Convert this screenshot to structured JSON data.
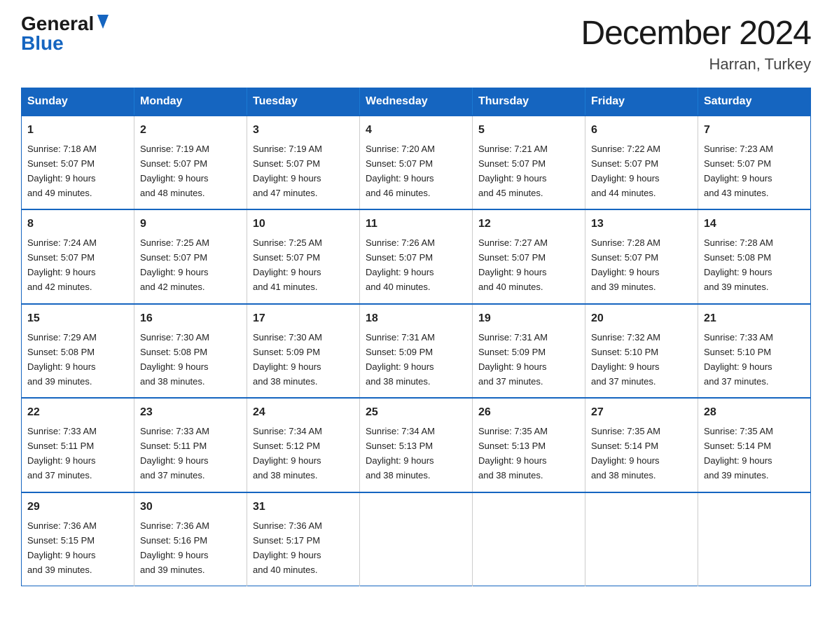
{
  "header": {
    "logo_general": "General",
    "logo_blue": "Blue",
    "title": "December 2024",
    "subtitle": "Harran, Turkey"
  },
  "days_of_week": [
    "Sunday",
    "Monday",
    "Tuesday",
    "Wednesday",
    "Thursday",
    "Friday",
    "Saturday"
  ],
  "weeks": [
    [
      {
        "day": "1",
        "sunrise": "7:18 AM",
        "sunset": "5:07 PM",
        "daylight": "9 hours and 49 minutes."
      },
      {
        "day": "2",
        "sunrise": "7:19 AM",
        "sunset": "5:07 PM",
        "daylight": "9 hours and 48 minutes."
      },
      {
        "day": "3",
        "sunrise": "7:19 AM",
        "sunset": "5:07 PM",
        "daylight": "9 hours and 47 minutes."
      },
      {
        "day": "4",
        "sunrise": "7:20 AM",
        "sunset": "5:07 PM",
        "daylight": "9 hours and 46 minutes."
      },
      {
        "day": "5",
        "sunrise": "7:21 AM",
        "sunset": "5:07 PM",
        "daylight": "9 hours and 45 minutes."
      },
      {
        "day": "6",
        "sunrise": "7:22 AM",
        "sunset": "5:07 PM",
        "daylight": "9 hours and 44 minutes."
      },
      {
        "day": "7",
        "sunrise": "7:23 AM",
        "sunset": "5:07 PM",
        "daylight": "9 hours and 43 minutes."
      }
    ],
    [
      {
        "day": "8",
        "sunrise": "7:24 AM",
        "sunset": "5:07 PM",
        "daylight": "9 hours and 42 minutes."
      },
      {
        "day": "9",
        "sunrise": "7:25 AM",
        "sunset": "5:07 PM",
        "daylight": "9 hours and 42 minutes."
      },
      {
        "day": "10",
        "sunrise": "7:25 AM",
        "sunset": "5:07 PM",
        "daylight": "9 hours and 41 minutes."
      },
      {
        "day": "11",
        "sunrise": "7:26 AM",
        "sunset": "5:07 PM",
        "daylight": "9 hours and 40 minutes."
      },
      {
        "day": "12",
        "sunrise": "7:27 AM",
        "sunset": "5:07 PM",
        "daylight": "9 hours and 40 minutes."
      },
      {
        "day": "13",
        "sunrise": "7:28 AM",
        "sunset": "5:07 PM",
        "daylight": "9 hours and 39 minutes."
      },
      {
        "day": "14",
        "sunrise": "7:28 AM",
        "sunset": "5:08 PM",
        "daylight": "9 hours and 39 minutes."
      }
    ],
    [
      {
        "day": "15",
        "sunrise": "7:29 AM",
        "sunset": "5:08 PM",
        "daylight": "9 hours and 39 minutes."
      },
      {
        "day": "16",
        "sunrise": "7:30 AM",
        "sunset": "5:08 PM",
        "daylight": "9 hours and 38 minutes."
      },
      {
        "day": "17",
        "sunrise": "7:30 AM",
        "sunset": "5:09 PM",
        "daylight": "9 hours and 38 minutes."
      },
      {
        "day": "18",
        "sunrise": "7:31 AM",
        "sunset": "5:09 PM",
        "daylight": "9 hours and 38 minutes."
      },
      {
        "day": "19",
        "sunrise": "7:31 AM",
        "sunset": "5:09 PM",
        "daylight": "9 hours and 37 minutes."
      },
      {
        "day": "20",
        "sunrise": "7:32 AM",
        "sunset": "5:10 PM",
        "daylight": "9 hours and 37 minutes."
      },
      {
        "day": "21",
        "sunrise": "7:33 AM",
        "sunset": "5:10 PM",
        "daylight": "9 hours and 37 minutes."
      }
    ],
    [
      {
        "day": "22",
        "sunrise": "7:33 AM",
        "sunset": "5:11 PM",
        "daylight": "9 hours and 37 minutes."
      },
      {
        "day": "23",
        "sunrise": "7:33 AM",
        "sunset": "5:11 PM",
        "daylight": "9 hours and 37 minutes."
      },
      {
        "day": "24",
        "sunrise": "7:34 AM",
        "sunset": "5:12 PM",
        "daylight": "9 hours and 38 minutes."
      },
      {
        "day": "25",
        "sunrise": "7:34 AM",
        "sunset": "5:13 PM",
        "daylight": "9 hours and 38 minutes."
      },
      {
        "day": "26",
        "sunrise": "7:35 AM",
        "sunset": "5:13 PM",
        "daylight": "9 hours and 38 minutes."
      },
      {
        "day": "27",
        "sunrise": "7:35 AM",
        "sunset": "5:14 PM",
        "daylight": "9 hours and 38 minutes."
      },
      {
        "day": "28",
        "sunrise": "7:35 AM",
        "sunset": "5:14 PM",
        "daylight": "9 hours and 39 minutes."
      }
    ],
    [
      {
        "day": "29",
        "sunrise": "7:36 AM",
        "sunset": "5:15 PM",
        "daylight": "9 hours and 39 minutes."
      },
      {
        "day": "30",
        "sunrise": "7:36 AM",
        "sunset": "5:16 PM",
        "daylight": "9 hours and 39 minutes."
      },
      {
        "day": "31",
        "sunrise": "7:36 AM",
        "sunset": "5:17 PM",
        "daylight": "9 hours and 40 minutes."
      },
      null,
      null,
      null,
      null
    ]
  ],
  "labels": {
    "sunrise": "Sunrise:",
    "sunset": "Sunset:",
    "daylight": "Daylight:"
  },
  "colors": {
    "header_bg": "#1565c0",
    "header_text": "#ffffff",
    "border": "#1565c0",
    "logo_blue": "#1565c0"
  }
}
